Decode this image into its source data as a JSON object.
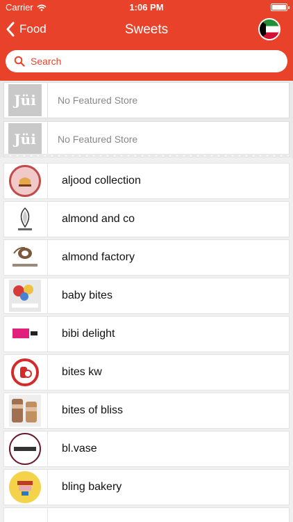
{
  "status": {
    "carrier": "Carrier",
    "time": "1:06 PM"
  },
  "nav": {
    "back_label": "Food",
    "title": "Sweets"
  },
  "search": {
    "placeholder": "Search"
  },
  "featured": [
    {
      "logo_text": "Jüi",
      "text": "No Featured Store"
    },
    {
      "logo_text": "Jüi",
      "text": "No Featured Store"
    }
  ],
  "stores": [
    {
      "name": "aljood collection",
      "logo": "aljood-logo"
    },
    {
      "name": "almond and co",
      "logo": "almond-and-co-logo"
    },
    {
      "name": "almond factory",
      "logo": "almond-factory-logo"
    },
    {
      "name": "baby bites",
      "logo": "baby-bites-logo"
    },
    {
      "name": "bibi delight",
      "logo": "bibi-delight-logo"
    },
    {
      "name": "bites kw",
      "logo": "bites-kw-logo"
    },
    {
      "name": "bites of bliss",
      "logo": "bites-of-bliss-logo"
    },
    {
      "name": "bl.vase",
      "logo": "bl-vase-logo"
    },
    {
      "name": "bling bakery",
      "logo": "bling-bakery-logo"
    }
  ],
  "colors": {
    "accent": "#e8432a",
    "background": "#f0f0f0"
  }
}
